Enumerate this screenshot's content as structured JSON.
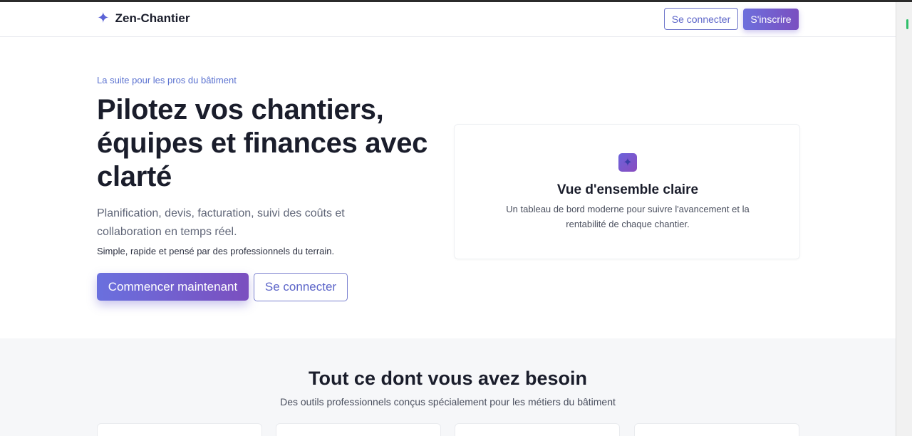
{
  "header": {
    "brand_icon": "sparkle-icon",
    "brand_name": "Zen-Chantier",
    "login_label": "Se connecter",
    "signup_label": "S'inscrire"
  },
  "hero": {
    "eyebrow": "La suite pour les pros du bâtiment",
    "title": "Pilotez vos chantiers, équipes et finances avec clarté",
    "subtitle": "Planification, devis, facturation, suivi des coûts et collaboration en temps réel.",
    "note": "Simple, rapide et pensé par des professionnels du terrain.",
    "start_label": "Commencer maintenant",
    "login_label": "Se connecter"
  },
  "overview": {
    "icon": "sparkle-icon",
    "title": "Vue d'ensemble claire",
    "text": "Un tableau de bord moderne pour suivre l'avancement et la rentabilité de chaque chantier."
  },
  "features": {
    "title": "Tout ce dont vous avez besoin",
    "subtitle": "Des outils professionnels conçus spécialement pour les métiers du bâtiment"
  },
  "colors": {
    "accent": "#6a70de",
    "accent_end": "#7b4fbf",
    "text": "#1a1d2b",
    "muted": "#5f6577"
  }
}
